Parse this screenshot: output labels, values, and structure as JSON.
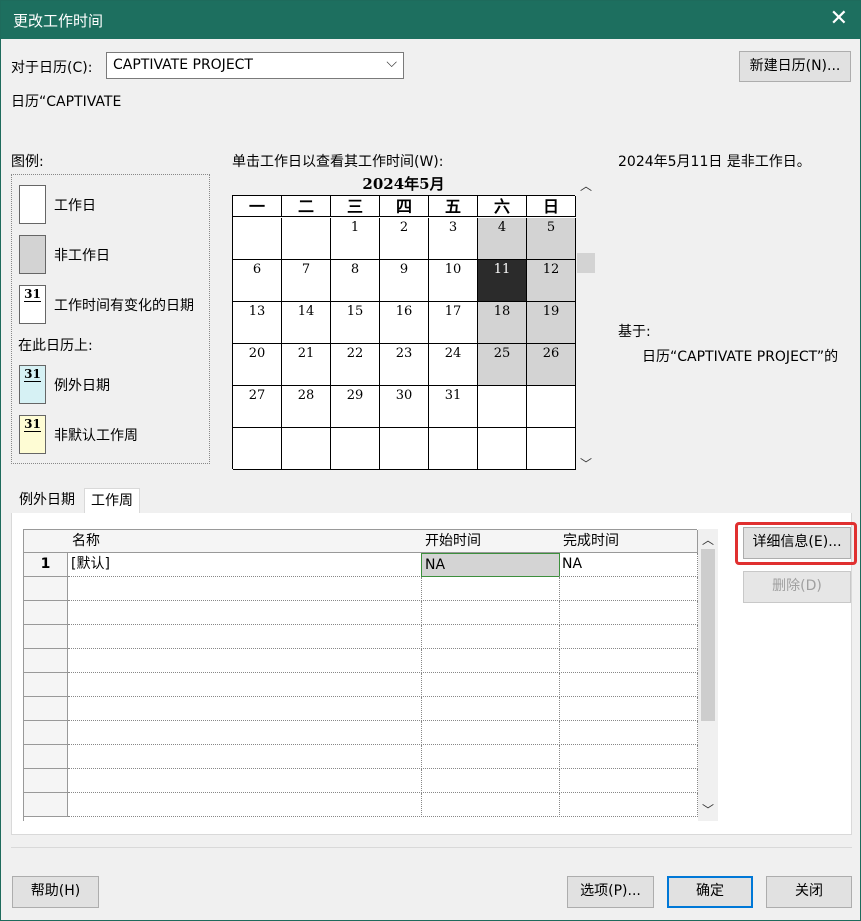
{
  "window": {
    "title": "更改工作时间",
    "close_glyph": "✕"
  },
  "calendar_selector": {
    "label": "对于日历(C):",
    "value": "CAPTIVATE PROJECT",
    "new_button": "新建日历(N)..."
  },
  "calendar_name_line": "日历“CAPTIVATE",
  "legend": {
    "title": "图例:",
    "items": [
      {
        "label": "工作日"
      },
      {
        "label": "非工作日"
      },
      {
        "label": "工作时间有变化的日期",
        "num": "31"
      }
    ],
    "subtitle": "在此日历上:",
    "cal_items": [
      {
        "label": "例外日期",
        "num": "31",
        "color": "#d6f1f4"
      },
      {
        "label": "非默认工作周",
        "num": "31",
        "color": "#fefcd4"
      }
    ]
  },
  "calendar": {
    "instruction": "单击工作日以查看其工作时间(W):",
    "month_title": "2024年5月",
    "weekdays": [
      "一",
      "二",
      "三",
      "四",
      "五",
      "六",
      "日"
    ],
    "weeks": [
      [
        "",
        "",
        "1",
        "2",
        "3",
        "4",
        "5"
      ],
      [
        "6",
        "7",
        "8",
        "9",
        "10",
        "11",
        "12"
      ],
      [
        "13",
        "14",
        "15",
        "16",
        "17",
        "18",
        "19"
      ],
      [
        "20",
        "21",
        "22",
        "23",
        "24",
        "25",
        "26"
      ],
      [
        "27",
        "28",
        "29",
        "30",
        "31",
        "",
        ""
      ],
      [
        "",
        "",
        "",
        "",
        "",
        "",
        ""
      ]
    ],
    "selected_day": "11"
  },
  "info": {
    "status": "2024年5月11日 是非工作日。",
    "based_on_label": "基于:",
    "based_on_value": "日历“CAPTIVATE PROJECT”的"
  },
  "tabs": [
    "例外日期",
    "工作周"
  ],
  "active_tab": "工作周",
  "grid": {
    "columns": [
      "名称",
      "开始时间",
      "完成时间"
    ],
    "rows": [
      {
        "num": "1",
        "name": "[默认]",
        "start": "NA",
        "finish": "NA"
      }
    ]
  },
  "side_buttons": {
    "details": "详细信息(E)...",
    "delete": "删除(D)"
  },
  "footer": {
    "help": "帮助(H)",
    "options": "选项(P)...",
    "ok": "确定",
    "close": "关闭"
  }
}
